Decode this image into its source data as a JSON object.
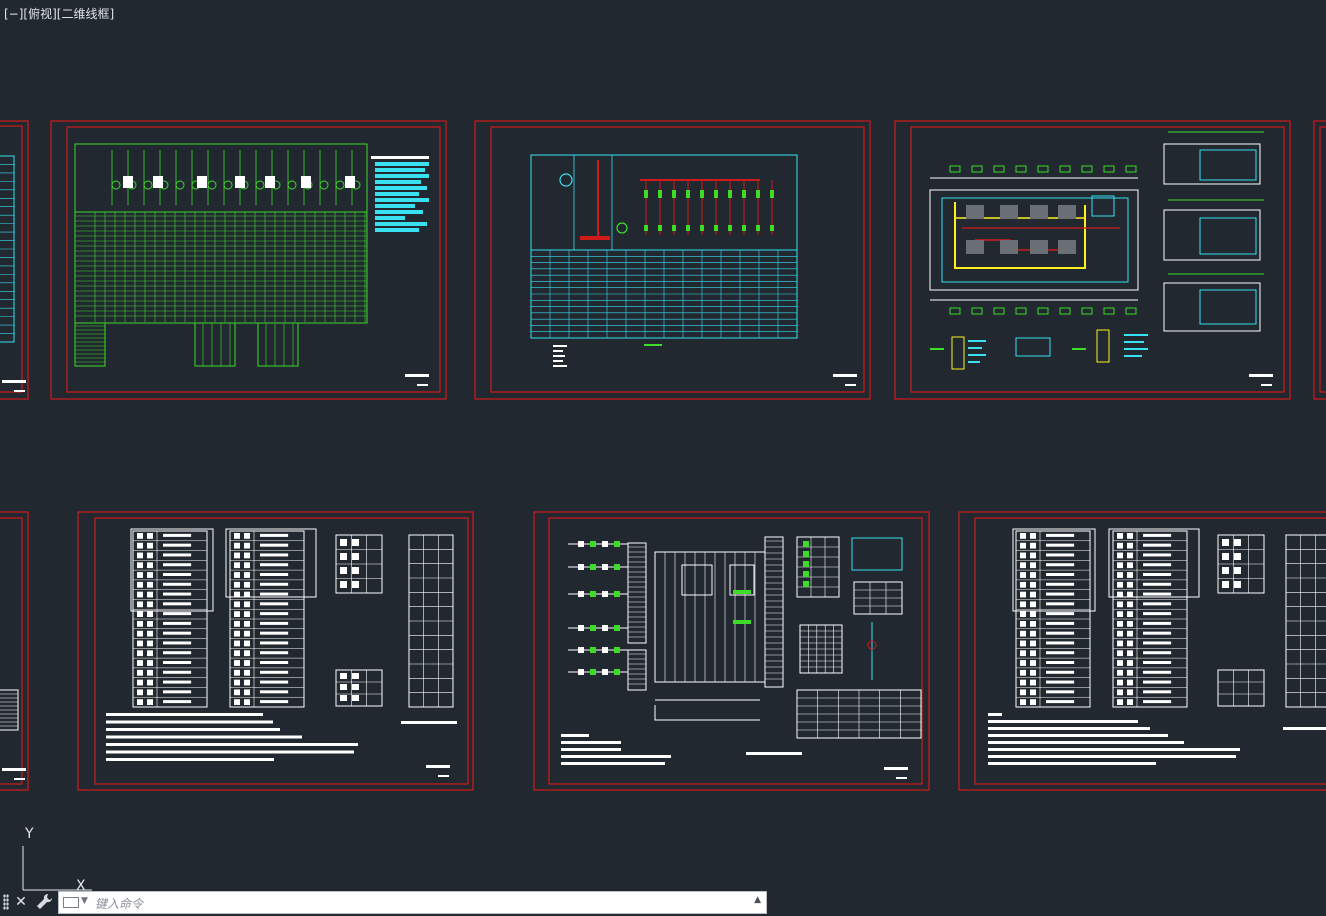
{
  "viewport": {
    "label": "[−][俯视][二维线框]"
  },
  "ucs": {
    "y_label": "Y",
    "x_label": "X"
  },
  "command": {
    "placeholder": "键入命令"
  },
  "colors": {
    "background": "#212830",
    "frame": "#d11a1a",
    "green": "#3ddc28",
    "cyan": "#38e0f0",
    "white": "#ffffff",
    "yellow": "#ffee22"
  },
  "sheets": [
    {
      "id": "partial-left-top",
      "kind": "table"
    },
    {
      "id": "sheet-1",
      "kind": "green-schematic"
    },
    {
      "id": "sheet-2",
      "kind": "cyan-schematic"
    },
    {
      "id": "sheet-3",
      "kind": "floor-plan"
    },
    {
      "id": "partial-right-top",
      "kind": "empty"
    },
    {
      "id": "partial-left-bottom",
      "kind": "table"
    },
    {
      "id": "sheet-4",
      "kind": "terminal-tables"
    },
    {
      "id": "sheet-5",
      "kind": "wiring-diagram"
    },
    {
      "id": "sheet-6",
      "kind": "terminal-tables"
    }
  ]
}
